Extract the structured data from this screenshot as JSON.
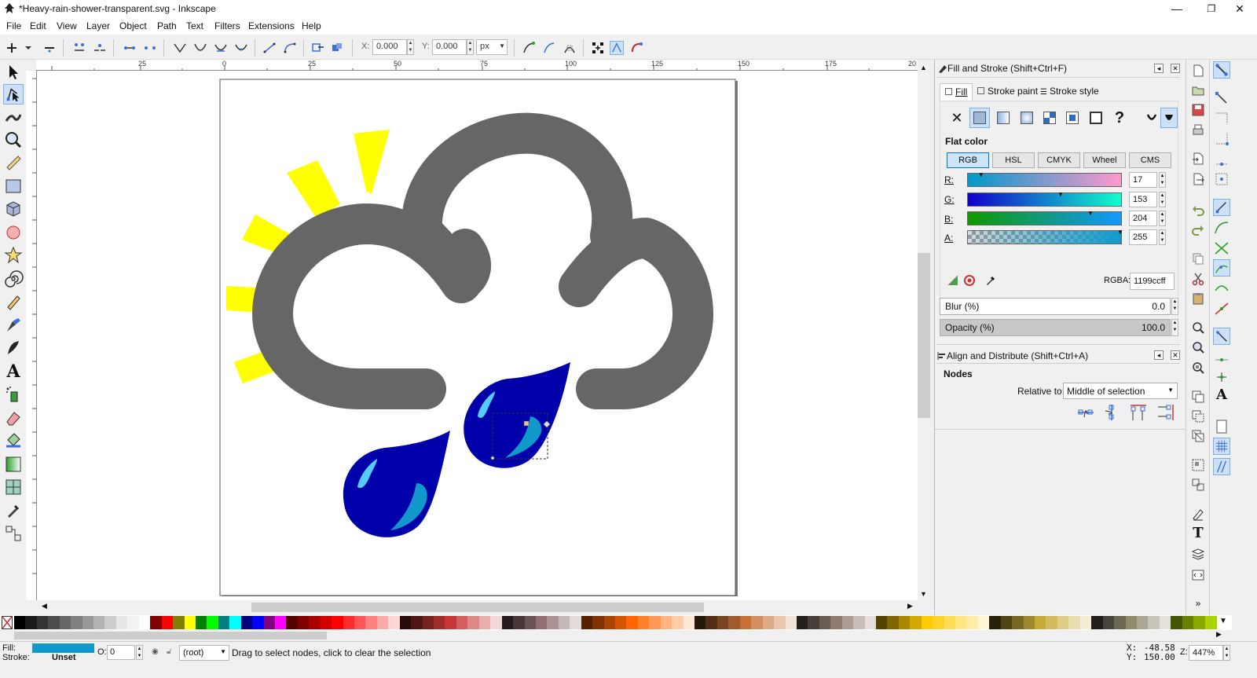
{
  "window": {
    "title": "*Heavy-rain-shower-transparent.svg - Inkscape",
    "minimize_glyph": "—",
    "maximize_glyph": "❐",
    "close_glyph": "✕"
  },
  "menu": {
    "items": [
      {
        "label": "File"
      },
      {
        "label": "Edit"
      },
      {
        "label": "View"
      },
      {
        "label": "Layer"
      },
      {
        "label": "Object"
      },
      {
        "label": "Path"
      },
      {
        "label": "Text"
      },
      {
        "label": "Filters"
      },
      {
        "label": "Extensions"
      },
      {
        "label": "Help"
      }
    ]
  },
  "toolbar": {
    "x_label": "X:",
    "x_value": "0.000",
    "y_label": "Y:",
    "y_value": "0.000",
    "unit": "px"
  },
  "rulers": {
    "h_ticks": [
      "25",
      "0",
      "25",
      "50",
      "75",
      "100",
      "125",
      "150",
      "175",
      "20"
    ],
    "v_ticks": [
      "0",
      "5",
      "0",
      "5",
      "0",
      "5",
      "0",
      "5",
      "0",
      "5",
      "0",
      "5",
      "0",
      "5",
      "0",
      "5",
      "0",
      "5",
      "0",
      "5",
      "0",
      "5"
    ]
  },
  "fill_stroke": {
    "title": "Fill and Stroke (Shift+Ctrl+F)",
    "tabs": [
      {
        "label": "Fill",
        "active": true
      },
      {
        "label": "Stroke paint",
        "active": false
      },
      {
        "label": "Stroke style",
        "active": false
      }
    ],
    "unset_glyph": "?",
    "flat_color_label": "Flat color",
    "color_modes": [
      {
        "label": "RGB",
        "active": true
      },
      {
        "label": "HSL",
        "active": false
      },
      {
        "label": "CMYK",
        "active": false
      },
      {
        "label": "Wheel",
        "active": false
      },
      {
        "label": "CMS",
        "active": false
      }
    ],
    "channels": [
      {
        "label": "R:",
        "value": "17",
        "level": 0.067
      },
      {
        "label": "G:",
        "value": "153",
        "level": 0.6
      },
      {
        "label": "B:",
        "value": "204",
        "level": 0.8
      },
      {
        "label": "A:",
        "value": "255",
        "level": 1.0
      }
    ],
    "rgba_label": "RGBA:",
    "rgba_value": "1199ccff",
    "blur_label": "Blur (%)",
    "blur_value": "0.0",
    "opacity_label": "Opacity (%)",
    "opacity_value": "100.0",
    "current_color": "#1199cc"
  },
  "align": {
    "title": "Align and Distribute (Shift+Ctrl+A)",
    "nodes_label": "Nodes",
    "relative_label": "Relative to:",
    "relative_value": "Middle of selection"
  },
  "statusbar": {
    "fill_label": "Fill:",
    "stroke_label": "Stroke:",
    "stroke_value": "Unset",
    "opacity_label": "O:",
    "opacity_value": "0",
    "layer_value": "(root)",
    "message": "Drag to select nodes, click to clear the selection",
    "coord_x_label": "X:",
    "coord_x": "-48.58",
    "coord_y_label": "Y:",
    "coord_y": "150.00",
    "zoom_label": "Z:",
    "zoom_value": "447%"
  },
  "artwork": {
    "sun_color": "#ffff00",
    "cloud_color": "#666666",
    "drop_color": "#0000aa",
    "highlight_light": "#55ccff",
    "highlight_mid": "#1199cc"
  }
}
